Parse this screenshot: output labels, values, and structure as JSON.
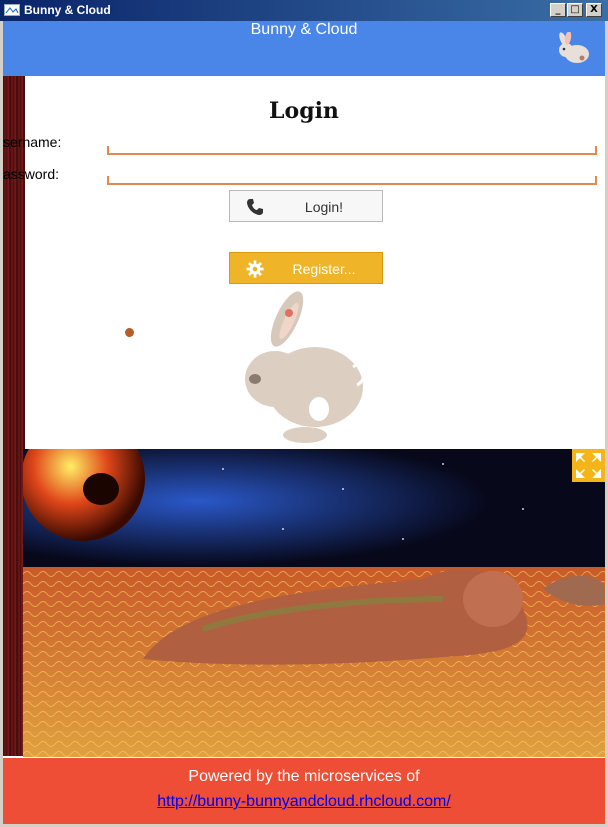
{
  "window": {
    "title": "Bunny & Cloud",
    "controls": [
      "_",
      "□",
      "X"
    ]
  },
  "header": {
    "title": "Bunny & Cloud"
  },
  "login": {
    "heading": "Login",
    "username_label": "sername:",
    "password_label": "assword:",
    "username_value": "",
    "password_value": "",
    "login_button": "Login!",
    "register_button": "Register..."
  },
  "footer": {
    "text": "Powered by the microservices of",
    "link": "http://bunny-bunnyandcloud.rhcloud.com/"
  },
  "colors": {
    "header": "#4a86e8",
    "footer": "#ee4e35",
    "register": "#f0b429",
    "field_underline": "#e08a4f",
    "fullscreen_button": "#f5b417"
  },
  "icons": {
    "app": "app-window-icon",
    "header": "bunny-icon",
    "login_button": "phone-icon",
    "register_button": "gear-icon",
    "scene": "fullscreen-icon"
  }
}
